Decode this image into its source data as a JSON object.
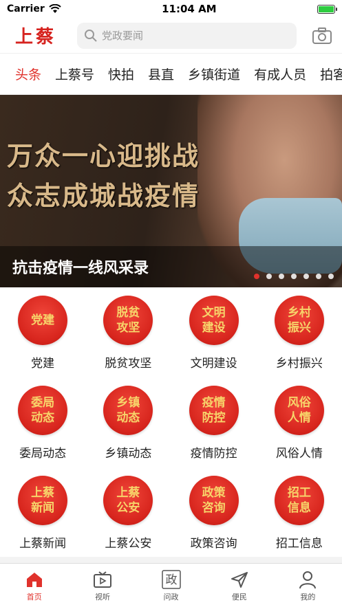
{
  "status": {
    "carrier": "Carrier",
    "time": "11:04 AM",
    "battery_level": 1.0
  },
  "header": {
    "logo": "上蔡",
    "search_placeholder": "党政要闻"
  },
  "tabs": [
    "头条",
    "上蔡号",
    "快拍",
    "县直",
    "乡镇街道",
    "有成人员",
    "拍客"
  ],
  "banner": {
    "slogan_line1": "万众一心迎挑战",
    "slogan_line2": "众志成城战疫情",
    "caption": "抗击疫情一线风采录",
    "dot_count": 7,
    "active_dot": 0
  },
  "grid": [
    {
      "icon_text": "党建",
      "label": "党建"
    },
    {
      "icon_text": "脱贫\n攻坚",
      "label": "脱贫攻坚"
    },
    {
      "icon_text": "文明\n建设",
      "label": "文明建设"
    },
    {
      "icon_text": "乡村\n振兴",
      "label": "乡村振兴"
    },
    {
      "icon_text": "委局\n动态",
      "label": "委局动态"
    },
    {
      "icon_text": "乡镇\n动态",
      "label": "乡镇动态"
    },
    {
      "icon_text": "疫情\n防控",
      "label": "疫情防控"
    },
    {
      "icon_text": "风俗\n人情",
      "label": "风俗人情"
    },
    {
      "icon_text": "上蔡\n新闻",
      "label": "上蔡新闻"
    },
    {
      "icon_text": "上蔡\n公安",
      "label": "上蔡公安"
    },
    {
      "icon_text": "政策\n咨询",
      "label": "政策咨询"
    },
    {
      "icon_text": "招工\n信息",
      "label": "招工信息"
    }
  ],
  "tabbar": [
    {
      "label": "首页",
      "icon": "home-icon"
    },
    {
      "label": "视听",
      "icon": "tv-icon"
    },
    {
      "label": "问政",
      "icon": "zheng-icon",
      "icon_text": "政"
    },
    {
      "label": "便民",
      "icon": "send-icon"
    },
    {
      "label": "我的",
      "icon": "user-icon"
    }
  ],
  "colors": {
    "accent": "#e0322c",
    "badge": "#d8261e",
    "badge_text": "#f7d46a"
  }
}
